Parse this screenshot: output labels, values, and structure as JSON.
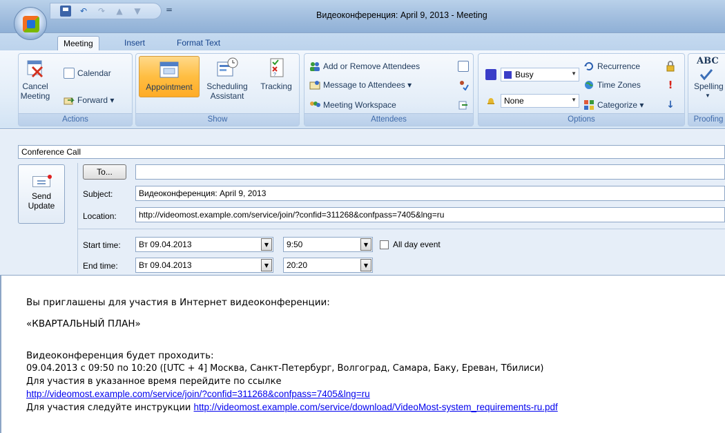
{
  "window": {
    "title": "Видеоконференция: April 9, 2013 - Meeting",
    "qat_separator": "="
  },
  "tabs": [
    {
      "label": "Meeting",
      "active": true
    },
    {
      "label": "Insert",
      "active": false
    },
    {
      "label": "Format Text",
      "active": false
    }
  ],
  "ribbon": {
    "actions": {
      "label": "Actions",
      "cancel_line1": "Cancel",
      "cancel_line2": "Meeting",
      "calendar": "Calendar",
      "forward": "Forward ▾"
    },
    "show": {
      "label": "Show",
      "appointment": "Appointment",
      "scheduling_line1": "Scheduling",
      "scheduling_line2": "Assistant",
      "tracking": "Tracking"
    },
    "attendees": {
      "label": "Attendees",
      "add_remove": "Add or Remove Attendees",
      "message": "Message to Attendees ▾",
      "workspace": "Meeting Workspace"
    },
    "options": {
      "label": "Options",
      "show_as": "Busy",
      "reminder": "None",
      "recurrence": "Recurrence",
      "time_zones": "Time Zones",
      "categorize": "Categorize ▾"
    },
    "proofing": {
      "label": "Proofing",
      "abc": "ABC",
      "spelling": "Spelling"
    }
  },
  "form": {
    "conversation": "Conference Call",
    "send_line1": "Send",
    "send_line2": "Update",
    "to_button": "To...",
    "to_value": "",
    "subject_label": "Subject:",
    "subject_value": "Видеоконференция: April 9, 2013",
    "location_label": "Location:",
    "location_value": "http://videomost.example.com/service/join/?confid=311268&confpass=7405&lng=ru",
    "start_label": "Start time:",
    "start_date": "Вт 09.04.2013",
    "start_time": "9:50",
    "all_day_label": "All day event",
    "all_day_checked": false,
    "end_label": "End time:",
    "end_date": "Вт 09.04.2013",
    "end_time": "20:20"
  },
  "body": {
    "line1": "Вы приглашены для участия в Интернет видеоконференции:",
    "line2": "«КВАРТАЛЬНЫЙ ПЛАН»",
    "line3": "Видеоконференция будет проходить:",
    "line4": "09.04.2013 с 09:50 по 10:20 ([UTC + 4] Москва, Санкт-Петербург, Волгоград, Самара, Баку, Ереван, Тбилиси)",
    "line5": "Для участия в указанное время перейдите по ссылке",
    "link1": "http://videomost.example.com/service/join/?confid=311268&confpass=7405&lng=ru",
    "line6_prefix": "Для участия следуйте инструкции ",
    "link2": "http://videomost.example.com/service/download/VideoMost-system_requirements-ru.pdf"
  },
  "colors": {
    "ribbon_bg": "#dfeaf7",
    "pressed": "#ffbe42",
    "link": "#0000ee",
    "busy_swatch": "#3a3dc8"
  }
}
